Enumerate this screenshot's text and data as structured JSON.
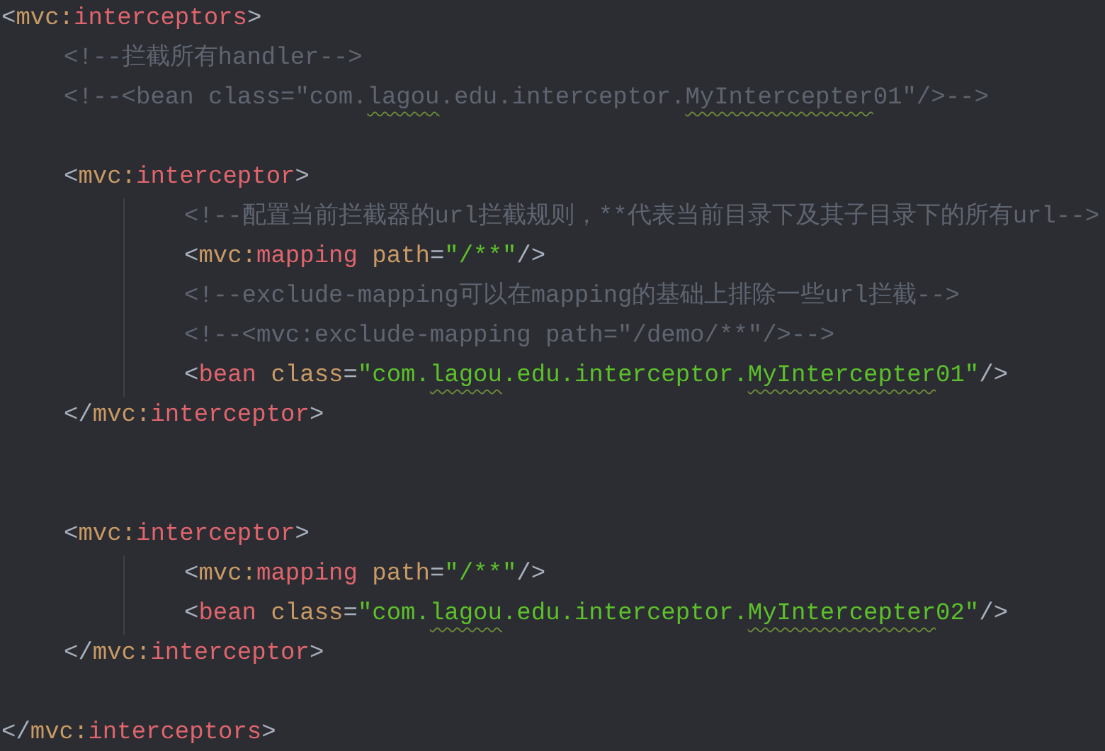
{
  "editor": {
    "lines": [
      {
        "kind": "code",
        "tokens": [
          {
            "kind": "bracket",
            "text": "<"
          },
          {
            "kind": "prefix",
            "text": "mvc:"
          },
          {
            "kind": "tag",
            "text": "interceptors"
          },
          {
            "kind": "bracket",
            "text": ">"
          }
        ],
        "children": [
          {
            "kind": "code",
            "tokens": [
              {
                "kind": "comment",
                "text": "<!--拦截所有handler-->"
              }
            ]
          },
          {
            "kind": "code",
            "tokens": [
              {
                "kind": "comment",
                "text": "<!--<bean class=\"com."
              },
              {
                "kind": "comment",
                "text": "lagou",
                "typo": true
              },
              {
                "kind": "comment",
                "text": ".edu.interceptor."
              },
              {
                "kind": "comment",
                "text": "MyIntercepter",
                "typo": true
              },
              {
                "kind": "comment",
                "text": "01\"/>-->"
              }
            ]
          },
          {
            "kind": "blank"
          },
          {
            "kind": "code",
            "tokens": [
              {
                "kind": "bracket",
                "text": "<"
              },
              {
                "kind": "prefix",
                "text": "mvc:"
              },
              {
                "kind": "tag",
                "text": "interceptor"
              },
              {
                "kind": "bracket",
                "text": ">"
              }
            ],
            "children": [
              {
                "kind": "code",
                "tokens": [
                  {
                    "kind": "comment",
                    "text": "<!--配置当前拦截器的url拦截规则，**代表当前目录下及其子目录下的所有url-->"
                  }
                ]
              },
              {
                "kind": "code",
                "tokens": [
                  {
                    "kind": "bracket",
                    "text": "<"
                  },
                  {
                    "kind": "prefix",
                    "text": "mvc:"
                  },
                  {
                    "kind": "tag",
                    "text": "mapping"
                  },
                  {
                    "kind": "attr",
                    "text": " path"
                  },
                  {
                    "kind": "bracket",
                    "text": "="
                  },
                  {
                    "kind": "value",
                    "text": "\"/**\""
                  },
                  {
                    "kind": "bracket",
                    "text": "/>"
                  }
                ]
              },
              {
                "kind": "code",
                "tokens": [
                  {
                    "kind": "comment",
                    "text": "<!--exclude-mapping可以在mapping的基础上排除一些url拦截-->"
                  }
                ]
              },
              {
                "kind": "code",
                "tokens": [
                  {
                    "kind": "comment",
                    "text": "<!--<mvc:exclude-mapping path=\"/demo/**\"/>-->"
                  }
                ]
              },
              {
                "kind": "code",
                "tokens": [
                  {
                    "kind": "bracket",
                    "text": "<"
                  },
                  {
                    "kind": "tag",
                    "text": "bean"
                  },
                  {
                    "kind": "attr",
                    "text": " class"
                  },
                  {
                    "kind": "bracket",
                    "text": "="
                  },
                  {
                    "kind": "value",
                    "text": "\"com."
                  },
                  {
                    "kind": "value",
                    "text": "lagou",
                    "typo": true
                  },
                  {
                    "kind": "value",
                    "text": ".edu.interceptor."
                  },
                  {
                    "kind": "value",
                    "text": "MyIntercepter",
                    "typo": true
                  },
                  {
                    "kind": "value",
                    "text": "01\""
                  },
                  {
                    "kind": "bracket",
                    "text": "/>"
                  }
                ]
              }
            ]
          },
          {
            "kind": "code",
            "tokens": [
              {
                "kind": "bracket",
                "text": "</"
              },
              {
                "kind": "prefix",
                "text": "mvc:"
              },
              {
                "kind": "tag",
                "text": "interceptor"
              },
              {
                "kind": "bracket",
                "text": ">"
              }
            ]
          },
          {
            "kind": "blank"
          },
          {
            "kind": "blank"
          },
          {
            "kind": "code",
            "tokens": [
              {
                "kind": "bracket",
                "text": "<"
              },
              {
                "kind": "prefix",
                "text": "mvc:"
              },
              {
                "kind": "tag",
                "text": "interceptor"
              },
              {
                "kind": "bracket",
                "text": ">"
              }
            ],
            "children": [
              {
                "kind": "code",
                "tokens": [
                  {
                    "kind": "bracket",
                    "text": "<"
                  },
                  {
                    "kind": "prefix",
                    "text": "mvc:"
                  },
                  {
                    "kind": "tag",
                    "text": "mapping"
                  },
                  {
                    "kind": "attr",
                    "text": " path"
                  },
                  {
                    "kind": "bracket",
                    "text": "="
                  },
                  {
                    "kind": "value",
                    "text": "\"/**\""
                  },
                  {
                    "kind": "bracket",
                    "text": "/>"
                  }
                ]
              },
              {
                "kind": "code",
                "tokens": [
                  {
                    "kind": "bracket",
                    "text": "<"
                  },
                  {
                    "kind": "tag",
                    "text": "bean"
                  },
                  {
                    "kind": "attr",
                    "text": " class"
                  },
                  {
                    "kind": "bracket",
                    "text": "="
                  },
                  {
                    "kind": "value",
                    "text": "\"com."
                  },
                  {
                    "kind": "value",
                    "text": "lagou",
                    "typo": true
                  },
                  {
                    "kind": "value",
                    "text": ".edu.interceptor."
                  },
                  {
                    "kind": "value",
                    "text": "MyIntercepter",
                    "typo": true
                  },
                  {
                    "kind": "value",
                    "text": "02\""
                  },
                  {
                    "kind": "bracket",
                    "text": "/>"
                  }
                ]
              }
            ]
          },
          {
            "kind": "code",
            "tokens": [
              {
                "kind": "bracket",
                "text": "</"
              },
              {
                "kind": "prefix",
                "text": "mvc:"
              },
              {
                "kind": "tag",
                "text": "interceptor"
              },
              {
                "kind": "bracket",
                "text": ">"
              }
            ]
          },
          {
            "kind": "blank"
          }
        ]
      },
      {
        "kind": "code",
        "tokens": [
          {
            "kind": "bracket",
            "text": "</"
          },
          {
            "kind": "prefix",
            "text": "mvc:"
          },
          {
            "kind": "tag",
            "text": "interceptors"
          },
          {
            "kind": "bracket",
            "text": ">"
          }
        ]
      }
    ]
  }
}
